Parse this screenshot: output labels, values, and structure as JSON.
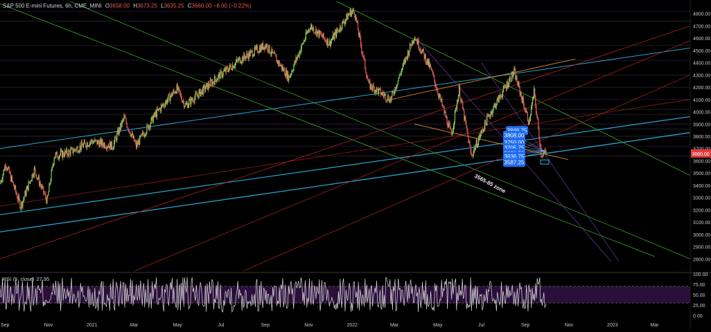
{
  "header": {
    "symbol": "S&P 500 E-mini Futures, 6h, CME_MINI",
    "open_label": "O",
    "open": "3658.00",
    "high_label": "H",
    "high": "3673.25",
    "low_label": "L",
    "low": "3635.25",
    "close_label": "C",
    "close": "3660.00",
    "change": "−8.00 (−0.22%)"
  },
  "colors": {
    "background": "#000000",
    "candle_up": "#8ad05a",
    "candle_down": "#e05a5a",
    "price_tag_bg": "#e03b3b",
    "target_box": "#1e6df0",
    "rsi_line": "#e0e0e0",
    "rsi_band": "#2a0f3a",
    "cyan": "#2bb8e8",
    "green": "#3a9a2a",
    "red": "#a02020",
    "orange": "#e0902a",
    "purple": "#6a3aa0"
  },
  "current_price_tag": "3660.00",
  "zone_label": "3565-85 zone",
  "chart_data": {
    "type": "candlestick",
    "title": "S&P 500 E-mini Futures, 6h, CME_MINI",
    "y_range": [
      2700,
      4900
    ],
    "y_ticks": [
      "4800.00",
      "4700.00",
      "4600.00",
      "4500.00",
      "4400.00",
      "4300.00",
      "4200.00",
      "4100.00",
      "4000.00",
      "3900.00",
      "3800.00",
      "3700.00",
      "3600.00",
      "3500.00",
      "3400.00",
      "3300.00",
      "3200.00",
      "3100.00",
      "3000.00",
      "2900.00",
      "2800.00"
    ],
    "x_ticks": [
      "Sep",
      "Nov",
      "2021",
      "Mar",
      "May",
      "Jul",
      "Sep",
      "Nov",
      "2022",
      "Mar",
      "May",
      "Jul",
      "Sep",
      "Nov",
      "2023",
      "Mar"
    ],
    "x_range": [
      "2020-08-25",
      "2023-04-20"
    ],
    "price_path": [
      [
        "2020-08-25",
        3410
      ],
      [
        "2020-09-02",
        3580
      ],
      [
        "2020-09-23",
        3230
      ],
      [
        "2020-10-12",
        3530
      ],
      [
        "2020-10-30",
        3270
      ],
      [
        "2020-11-09",
        3640
      ],
      [
        "2020-12-01",
        3670
      ],
      [
        "2020-12-31",
        3760
      ],
      [
        "2021-01-30",
        3720
      ],
      [
        "2021-02-15",
        3950
      ],
      [
        "2021-03-04",
        3720
      ],
      [
        "2021-03-31",
        3980
      ],
      [
        "2021-04-30",
        4190
      ],
      [
        "2021-05-12",
        4050
      ],
      [
        "2021-06-30",
        4300
      ],
      [
        "2021-07-26",
        4420
      ],
      [
        "2021-08-31",
        4540
      ],
      [
        "2021-09-02",
        4545
      ],
      [
        "2021-10-04",
        4280
      ],
      [
        "2021-11-03",
        4700
      ],
      [
        "2021-11-30",
        4560
      ],
      [
        "2021-12-29",
        4810
      ],
      [
        "2022-01-04",
        4818
      ],
      [
        "2022-01-24",
        4220
      ],
      [
        "2022-02-24",
        4100
      ],
      [
        "2022-03-29",
        4620
      ],
      [
        "2022-04-21",
        4350
      ],
      [
        "2022-05-20",
        3810
      ],
      [
        "2022-05-31",
        4180
      ],
      [
        "2022-06-17",
        3640
      ],
      [
        "2022-07-10",
        3950
      ],
      [
        "2022-08-16",
        4325
      ],
      [
        "2022-09-06",
        3910
      ],
      [
        "2022-09-13",
        4160
      ],
      [
        "2022-09-23",
        3660
      ],
      [
        "2022-09-30",
        3660
      ]
    ],
    "price_targets": [
      "3846.75",
      "3808.00",
      "3750.00",
      "3705.75",
      "3661.50",
      "3636.75",
      "3587.25"
    ],
    "rsi": {
      "label": "RSI (5, close)",
      "value": "27.95",
      "y_range": [
        0,
        100
      ],
      "ticks": [
        "100.00",
        "75.00",
        "50.00",
        "25.00",
        "0.00"
      ],
      "band": [
        30,
        70
      ]
    }
  }
}
